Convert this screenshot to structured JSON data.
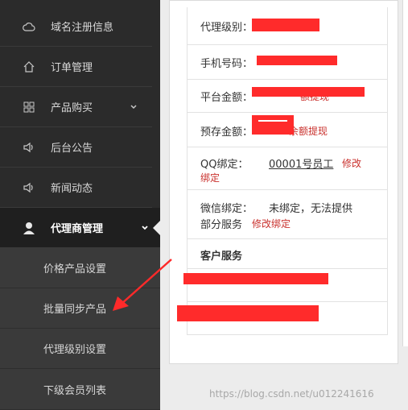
{
  "sidebar": {
    "items": [
      {
        "label": "域名注册信息",
        "icon": "cloud-icon"
      },
      {
        "label": "订单管理",
        "icon": "home-icon"
      },
      {
        "label": "产品购买",
        "icon": "grid-icon"
      },
      {
        "label": "后台公告",
        "icon": "speaker-icon"
      },
      {
        "label": "新闻动态",
        "icon": "speaker-icon"
      },
      {
        "label": "代理商管理",
        "icon": "user-icon"
      }
    ],
    "sub_items": [
      {
        "label": "价格产品设置"
      },
      {
        "label": "批量同步产品"
      },
      {
        "label": "代理级别设置"
      },
      {
        "label": "下级会员列表"
      }
    ]
  },
  "panel": {
    "agent_level_label": "代理级别：",
    "phone_label": "手机号码：",
    "platform_amount_label": "平台金额：",
    "platform_amount_link": "额提现",
    "prestore_label": "预存金额：",
    "prestore_link": "余额提现",
    "qq_label": "QQ绑定：",
    "qq_value": "00001号员工",
    "qq_link_1": "修改",
    "qq_link_2": "绑定",
    "wechat_label": "微信绑定：",
    "wechat_value": "未绑定，无法提供",
    "wechat_value_2": "部分服务",
    "wechat_link": "修改绑定",
    "customer_service_title": "客户服务"
  },
  "watermark": "https://blog.csdn.net/u012241616",
  "colors": {
    "accent_red": "#c9302c",
    "redaction": "#ff2b2b",
    "sidebar_bg": "#2b2b2b"
  }
}
